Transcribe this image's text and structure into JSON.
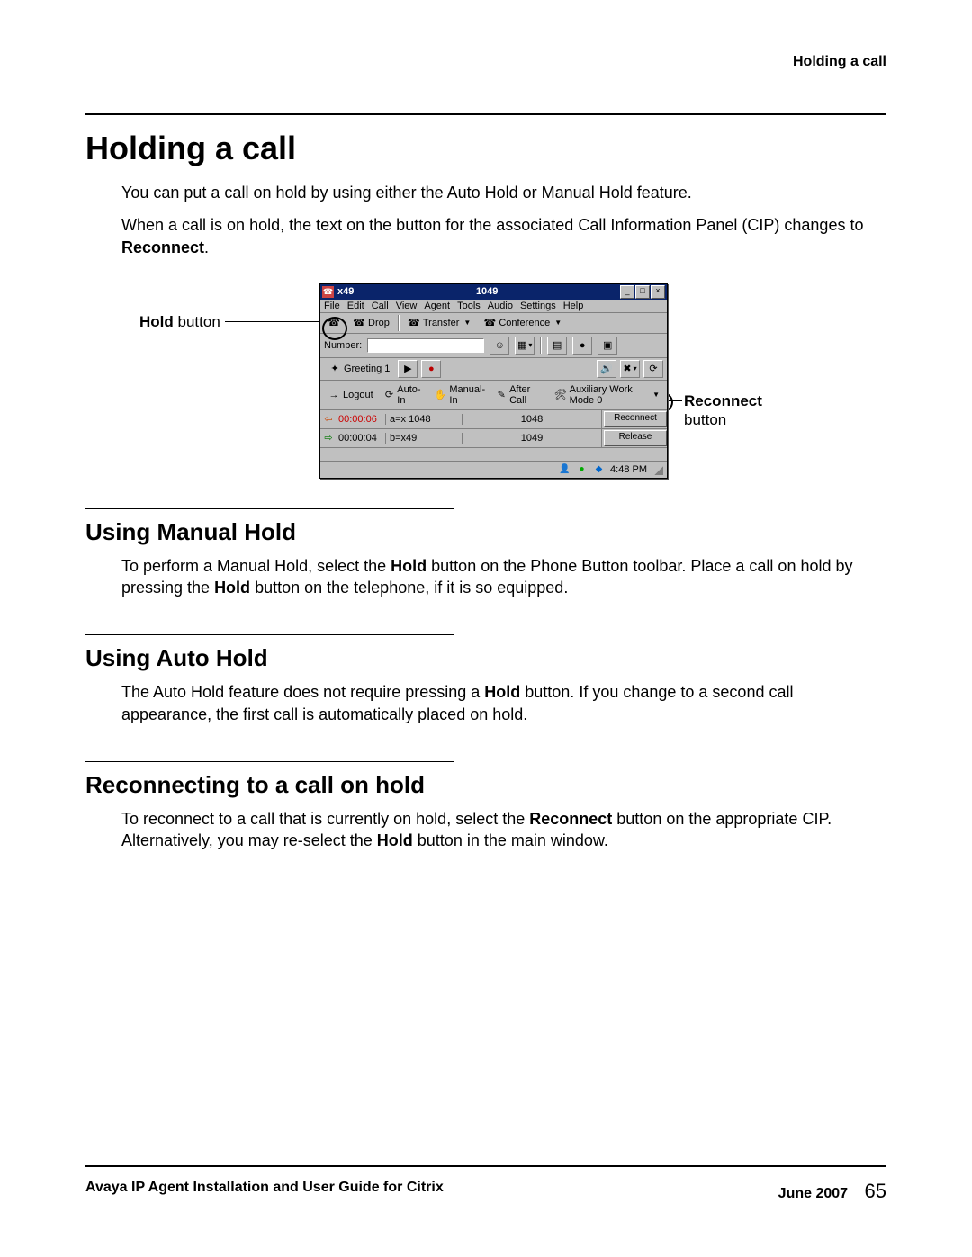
{
  "running_head": "Holding a call",
  "h1": "Holding a call",
  "intro_p1": "You can put a call on hold by using either the Auto Hold or Manual Hold feature.",
  "intro_p2_a": "When a call is on hold, the text on the button for the associated Call Information Panel (CIP) changes to ",
  "intro_p2_b": "Reconnect",
  "intro_p2_c": ".",
  "callouts": {
    "hold_bold": "Hold",
    "hold_rest": " button",
    "reconnect_bold": "Reconnect",
    "reconnect_rest": "button"
  },
  "app": {
    "title_left": "x49",
    "title_center": "1049",
    "win_min": "_",
    "win_max": "□",
    "win_close": "×",
    "menu": [
      "File",
      "Edit",
      "Call",
      "View",
      "Agent",
      "Tools",
      "Audio",
      "Settings",
      "Help"
    ],
    "toolbar1": {
      "drop": "Drop",
      "transfer": "Transfer",
      "conference": "Conference"
    },
    "number_label": "Number:",
    "greeting": "Greeting 1",
    "agentbar": {
      "logout": "Logout",
      "autoin": "Auto-In",
      "manualin": "Manual-In",
      "aftercall": "After Call",
      "auxwork": "Auxiliary Work Mode 0"
    },
    "cips": [
      {
        "time": "00:00:06",
        "info": "a=x 1048",
        "num": "1048",
        "btn": "Reconnect",
        "held": true
      },
      {
        "time": "00:00:04",
        "info": "b=x49",
        "num": "1049",
        "btn": "Release",
        "held": false
      }
    ],
    "status_time": "4:48 PM"
  },
  "sec_manual_h": "Using Manual Hold",
  "sec_manual_p_a": "To perform a Manual Hold, select the ",
  "sec_manual_p_b": "Hold",
  "sec_manual_p_c": " button on the Phone Button toolbar. Place a call on hold by pressing the ",
  "sec_manual_p_d": "Hold",
  "sec_manual_p_e": " button on the telephone, if it is so equipped.",
  "sec_auto_h": "Using Auto Hold",
  "sec_auto_p_a": "The Auto Hold feature does not require pressing a ",
  "sec_auto_p_b": "Hold",
  "sec_auto_p_c": " button. If you change to a second call appearance, the first call is automatically placed on hold.",
  "sec_recon_h": "Reconnecting to a call on hold",
  "sec_recon_p_a": "To reconnect to a call that is currently on hold, select the ",
  "sec_recon_p_b": "Reconnect",
  "sec_recon_p_c": " button on the appropriate CIP. Alternatively, you may re-select the ",
  "sec_recon_p_d": "Hold",
  "sec_recon_p_e": " button in the main window.",
  "footer_left": "Avaya IP Agent Installation and User Guide for Citrix",
  "footer_date": "June 2007",
  "footer_page": "65"
}
